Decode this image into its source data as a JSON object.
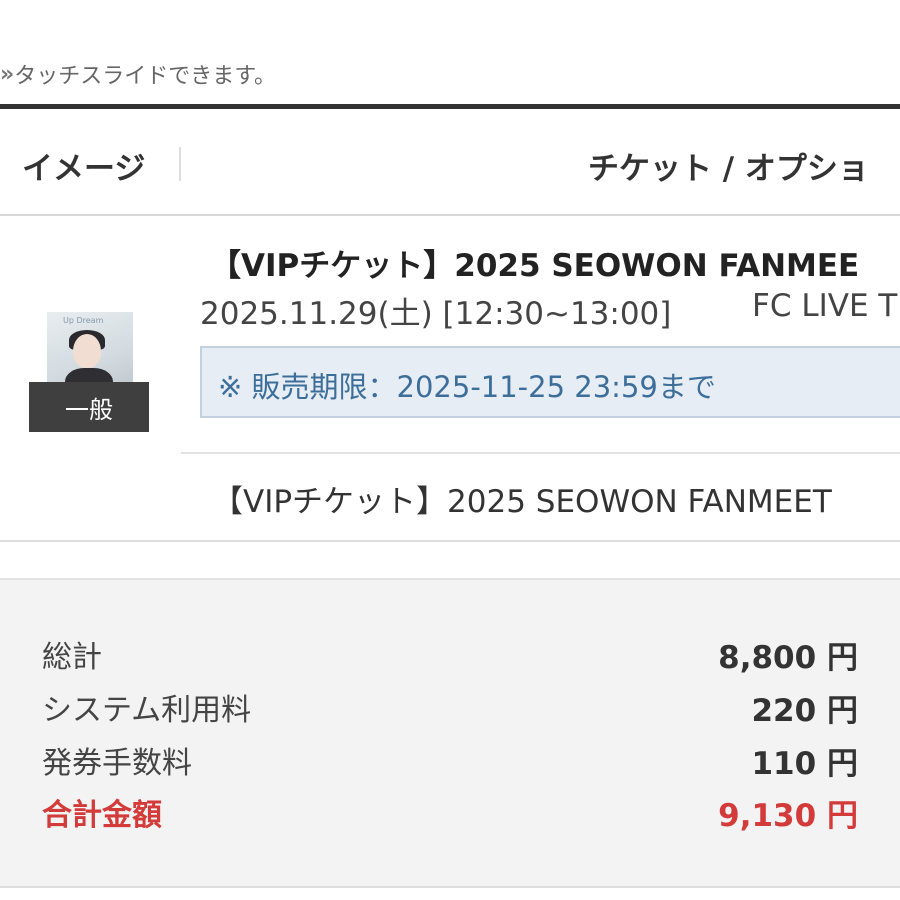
{
  "hint": {
    "arrows": "»",
    "text": "タッチスライドできます。"
  },
  "table_header": {
    "image": "イメージ",
    "ticket_option": "チケット / オプショ"
  },
  "item": {
    "badge": "一般",
    "thumbnail_text": "Up Dream",
    "title": "【VIPチケット】2025 SEOWON FANMEE",
    "date": "2025.11.29(土) [12:30~13:00]",
    "venue": "FC LIVE T",
    "sale_deadline": "※ 販売期限：2025-11-25 23:59まで",
    "option": "【VIPチケット】2025 SEOWON FANMEET"
  },
  "summary": {
    "rows": [
      {
        "label": "総計",
        "value": "8,800 円"
      },
      {
        "label": "システム利用料",
        "value": "220 円"
      },
      {
        "label": "発券手数料",
        "value": "110 円"
      }
    ],
    "total": {
      "label": "合計金額",
      "value": "9,130 円"
    }
  },
  "colors": {
    "accent_red": "#d33a3a",
    "sale_text_blue": "#3d6e9a",
    "sale_box_bg": "#e6edf5",
    "badge_bg": "#3f3f3f"
  }
}
